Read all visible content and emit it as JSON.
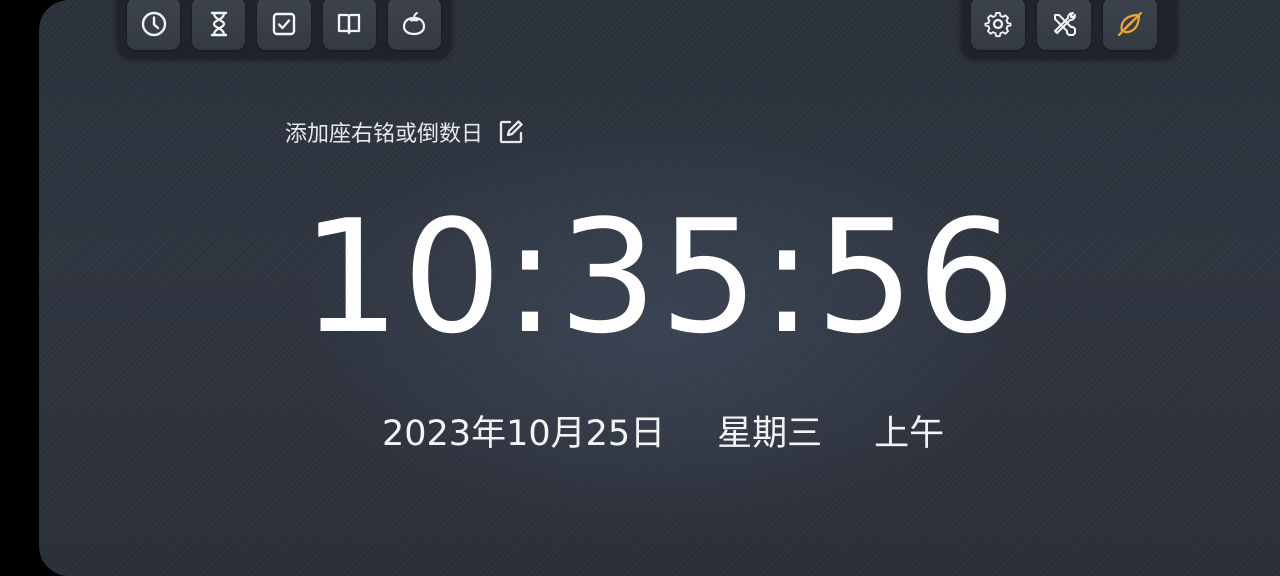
{
  "toolbar_left": {
    "buttons": [
      {
        "icon": "clock-icon",
        "label": ""
      },
      {
        "icon": "hourglass-icon",
        "label": ""
      },
      {
        "icon": "checkbox-icon",
        "label": ""
      },
      {
        "icon": "book-icon",
        "label": ""
      },
      {
        "icon": "tomato-icon",
        "label": ""
      }
    ]
  },
  "toolbar_right": {
    "buttons": [
      {
        "icon": "gear-icon",
        "label": ""
      },
      {
        "icon": "tools-icon",
        "label": ""
      },
      {
        "icon": "leaf-off-icon",
        "label": "",
        "color": "#f0a531"
      }
    ]
  },
  "motto": {
    "text": "添加座右铭或倒数日",
    "icon": "edit-icon"
  },
  "clock": {
    "time": "10:35:56"
  },
  "date": {
    "date": "2023年10月25日",
    "weekday": "星期三",
    "ampm": "上午"
  },
  "colors": {
    "accent": "#f0a531",
    "icon": "#f2f3f5",
    "text": "#ffffff"
  }
}
